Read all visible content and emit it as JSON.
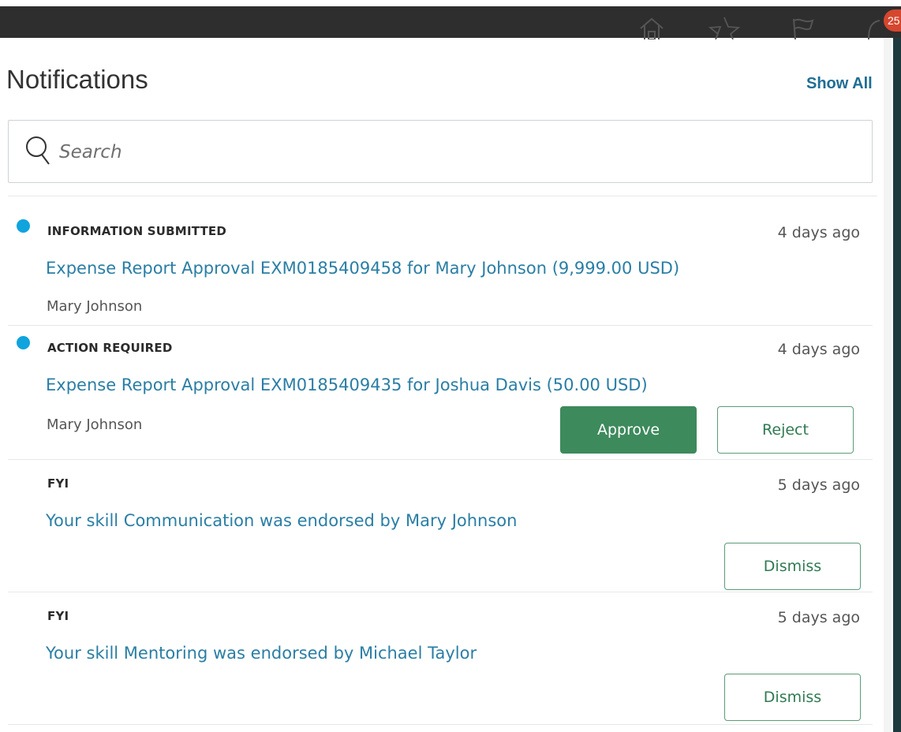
{
  "header": {
    "icons": [
      "home-icon",
      "star-icon",
      "flag-icon",
      "bell-icon"
    ],
    "badge_count": "25"
  },
  "panel": {
    "title": "Notifications",
    "show_all_label": "Show All"
  },
  "search": {
    "placeholder": "Search",
    "value": ""
  },
  "notifications": [
    {
      "unread": true,
      "category": "INFORMATION SUBMITTED",
      "time": "4 days ago",
      "subject": "Expense Report Approval EXM0185409458 for Mary Johnson (9,999.00 USD)",
      "sender": "Mary Johnson"
    },
    {
      "unread": true,
      "category": "ACTION REQUIRED",
      "time": "4 days ago",
      "subject": "Expense Report Approval EXM0185409435 for Joshua Davis (50.00 USD)",
      "sender": "Mary Johnson",
      "approve_label": "Approve",
      "reject_label": "Reject"
    },
    {
      "unread": false,
      "category": "FYI",
      "time": "5 days ago",
      "subject": "Your skill Communication was endorsed by Mary Johnson",
      "dismiss_label": "Dismiss"
    },
    {
      "unread": false,
      "category": "FYI",
      "time": "5 days ago",
      "subject": "Your skill Mentoring was endorsed by Michael Taylor",
      "dismiss_label": "Dismiss"
    }
  ],
  "colors": {
    "link": "#2a7ea5",
    "unread_dot": "#0fa4dd",
    "approve_bg": "#3d8a5c",
    "badge": "#d6462e",
    "topbar": "#2e2e2e"
  }
}
